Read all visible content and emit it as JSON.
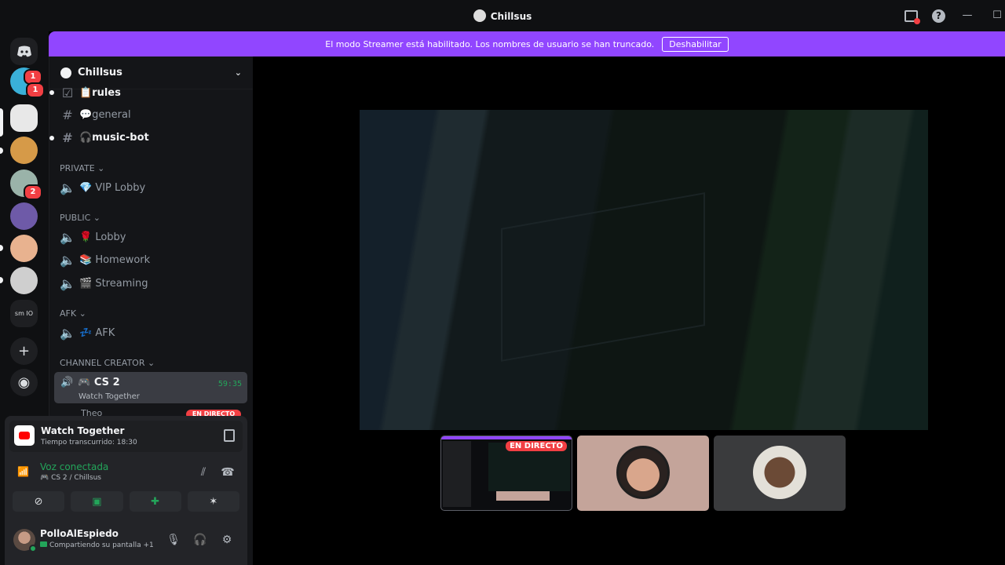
{
  "window": {
    "title": "Chillsus"
  },
  "banner": {
    "text": "El modo Streamer está habilitado. Los nombres de usuario se han truncado.",
    "button": "Deshabilitar"
  },
  "guilds": {
    "badges": [
      "1",
      "1",
      "2"
    ],
    "text_icon": "sm",
    "text_icon2": "IO"
  },
  "server": {
    "name": "Chillsus",
    "channels": [
      {
        "label": "📋rules",
        "type": "text",
        "unread": true
      },
      {
        "label": "💬general",
        "type": "text",
        "unread": false
      },
      {
        "label": "🎧music-bot",
        "type": "text",
        "unread": true
      }
    ],
    "categories": {
      "private": "PRIVATE",
      "public": "PUBLIC",
      "afk": "AFK",
      "creator": "CHANNEL CREATOR"
    },
    "private_channels": [
      "💎 VIP Lobby"
    ],
    "public_channels": [
      "🌹 Lobby",
      "📚 Homework",
      "🎬 Streaming"
    ],
    "afk_channels": [
      "💤 AFK"
    ],
    "active_voice": {
      "name": "🎮 CS 2",
      "activity": "Watch Together",
      "timer": "59:35"
    },
    "peek_user": "Theo",
    "peek_live": "EN DIRECTO"
  },
  "panel": {
    "activity_title": "Watch Together",
    "activity_sub": "Tiempo transcurrido: 18:30",
    "voice_title": "Voz conectada",
    "voice_sub": "🎮 CS 2 / Chillsus",
    "user_name": "PolloAlEspiedo",
    "user_status": "Compartiendo su pantalla +1"
  },
  "stage": {
    "live_label": "EN DIRECTO"
  },
  "icons": {
    "discord": "discord-logo-icon",
    "help": "help-icon",
    "inbox": "inbox-icon"
  }
}
